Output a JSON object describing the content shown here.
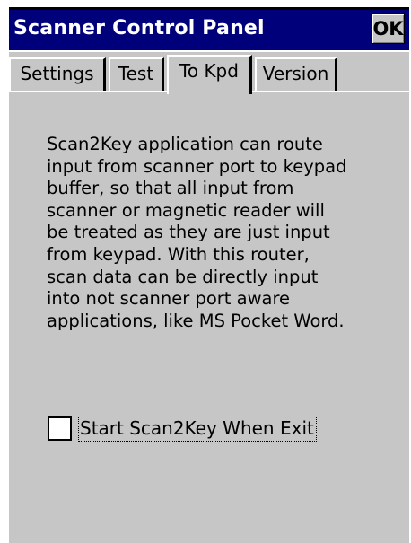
{
  "window": {
    "title": "Scanner Control Panel",
    "ok_label": "OK"
  },
  "tabs": [
    {
      "label": "Settings",
      "active": false
    },
    {
      "label": "Test",
      "active": false
    },
    {
      "label": "To Kpd",
      "active": true
    },
    {
      "label": "Version",
      "active": false
    }
  ],
  "content": {
    "description": "Scan2Key application can route input from scanner port to keypad buffer, so that all input from scanner or magnetic reader will be treated as they are just input from keypad. With this router, scan data can be directly input into not scanner port aware applications, like MS Pocket Word.",
    "checkbox": {
      "label": "Start Scan2Key When Exit",
      "checked": false
    }
  },
  "colors": {
    "titlebar": "#00007a",
    "background": "#c6c6c6"
  }
}
